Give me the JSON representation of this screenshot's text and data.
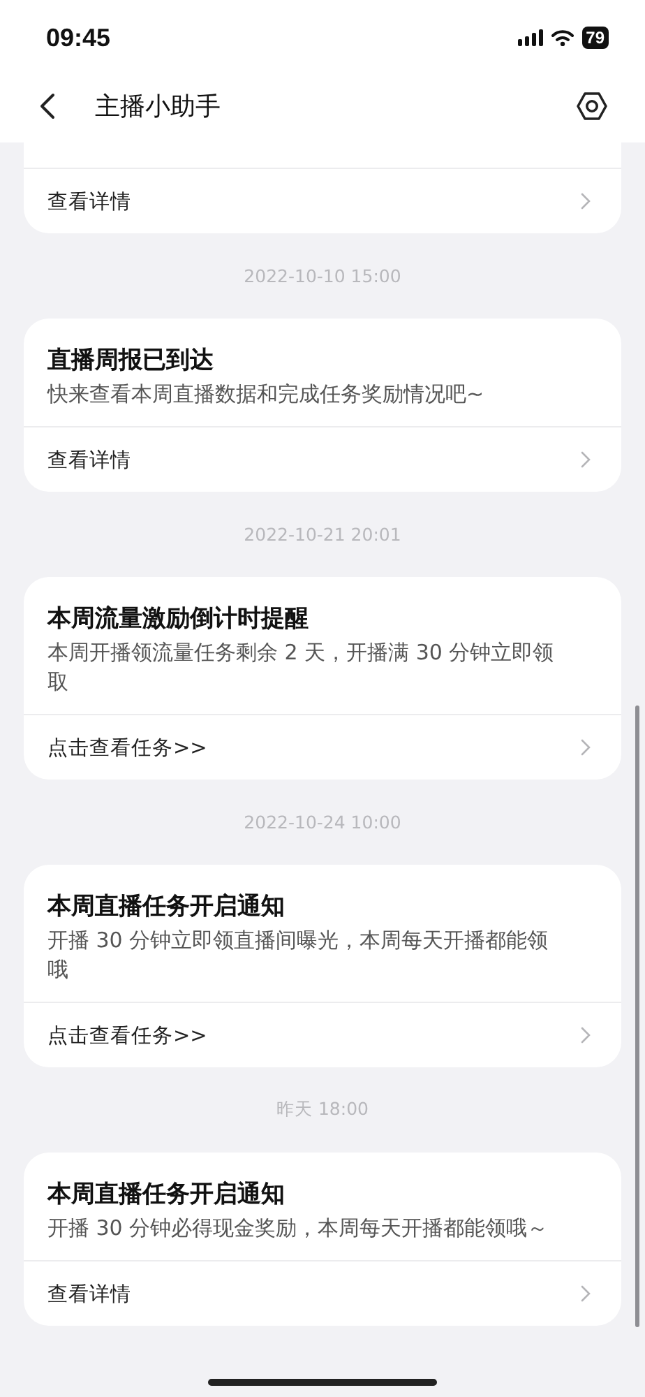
{
  "status_bar": {
    "time": "09:45",
    "battery": "79"
  },
  "nav": {
    "title": "主播小助手"
  },
  "feed": [
    {
      "kind": "card",
      "action": "查看详情"
    },
    {
      "kind": "time",
      "text": "2022-10-10 15:00"
    },
    {
      "kind": "card",
      "title": "直播周报已到达",
      "body": "快来查看本周直播数据和完成任务奖励情况吧~",
      "action": "查看详情"
    },
    {
      "kind": "time",
      "text": "2022-10-21 20:01"
    },
    {
      "kind": "card",
      "title": "本周流量激励倒计时提醒",
      "body": "本周开播领流量任务剩余 2 天，开播满 30 分钟立即领取",
      "action": "点击查看任务>>"
    },
    {
      "kind": "time",
      "text": "2022-10-24 10:00"
    },
    {
      "kind": "card",
      "title": "本周直播任务开启通知",
      "body": "开播 30 分钟立即领直播间曝光，本周每天开播都能领哦",
      "action": "点击查看任务>>"
    },
    {
      "kind": "time",
      "text": "昨天 18:00"
    },
    {
      "kind": "card",
      "title": "本周直播任务开启通知",
      "body": "开播 30 分钟必得现金奖励，本周每天开播都能领哦～",
      "action": "查看详情"
    }
  ]
}
